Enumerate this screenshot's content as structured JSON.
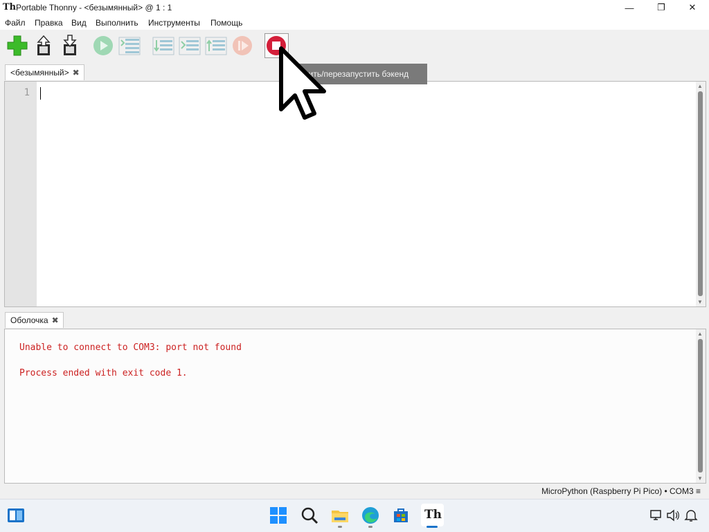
{
  "window": {
    "title": "Portable Thonny  -  <безымянный>  @  1 : 1",
    "app_icon": "Th",
    "controls": {
      "minimize": "—",
      "maximize": "❐",
      "close": "✕"
    }
  },
  "menu": [
    "Файл",
    "Правка",
    "Вид",
    "Выполнить",
    "Инструменты",
    "Помощь"
  ],
  "toolbar": {
    "buttons": [
      "new-file",
      "open-file",
      "save-file",
      "run",
      "debug",
      "step-over",
      "step-into",
      "step-out",
      "resume",
      "stop-restart"
    ],
    "tooltip": "Остановить/перезапустить бэкенд",
    "tooltip_visible_text": "новить/перезапустить бэкенд"
  },
  "editor": {
    "tab_label": "<безымянный>",
    "close_glyph": "✖",
    "line_numbers": [
      "1"
    ]
  },
  "shell": {
    "tab_label": "Оболочка",
    "close_glyph": "✖",
    "lines": [
      "Unable to connect to COM3: port not found",
      "Process ended with exit code 1."
    ],
    "error_color": "#cc2222"
  },
  "status": {
    "interpreter": "MicroPython (Raspberry Pi Pico)  •  COM3  ≡"
  },
  "colors": {
    "run_green": "#6cc08f",
    "add_green": "#3cbb2a",
    "stop_red": "#d41f3a"
  },
  "taskbar": {
    "icons": [
      "widgets-icon",
      "start-icon",
      "search-icon",
      "file-explorer-icon",
      "edge-icon",
      "store-icon",
      "thonny-icon"
    ],
    "tray": [
      "network-icon",
      "volume-icon",
      "notification-icon"
    ]
  }
}
